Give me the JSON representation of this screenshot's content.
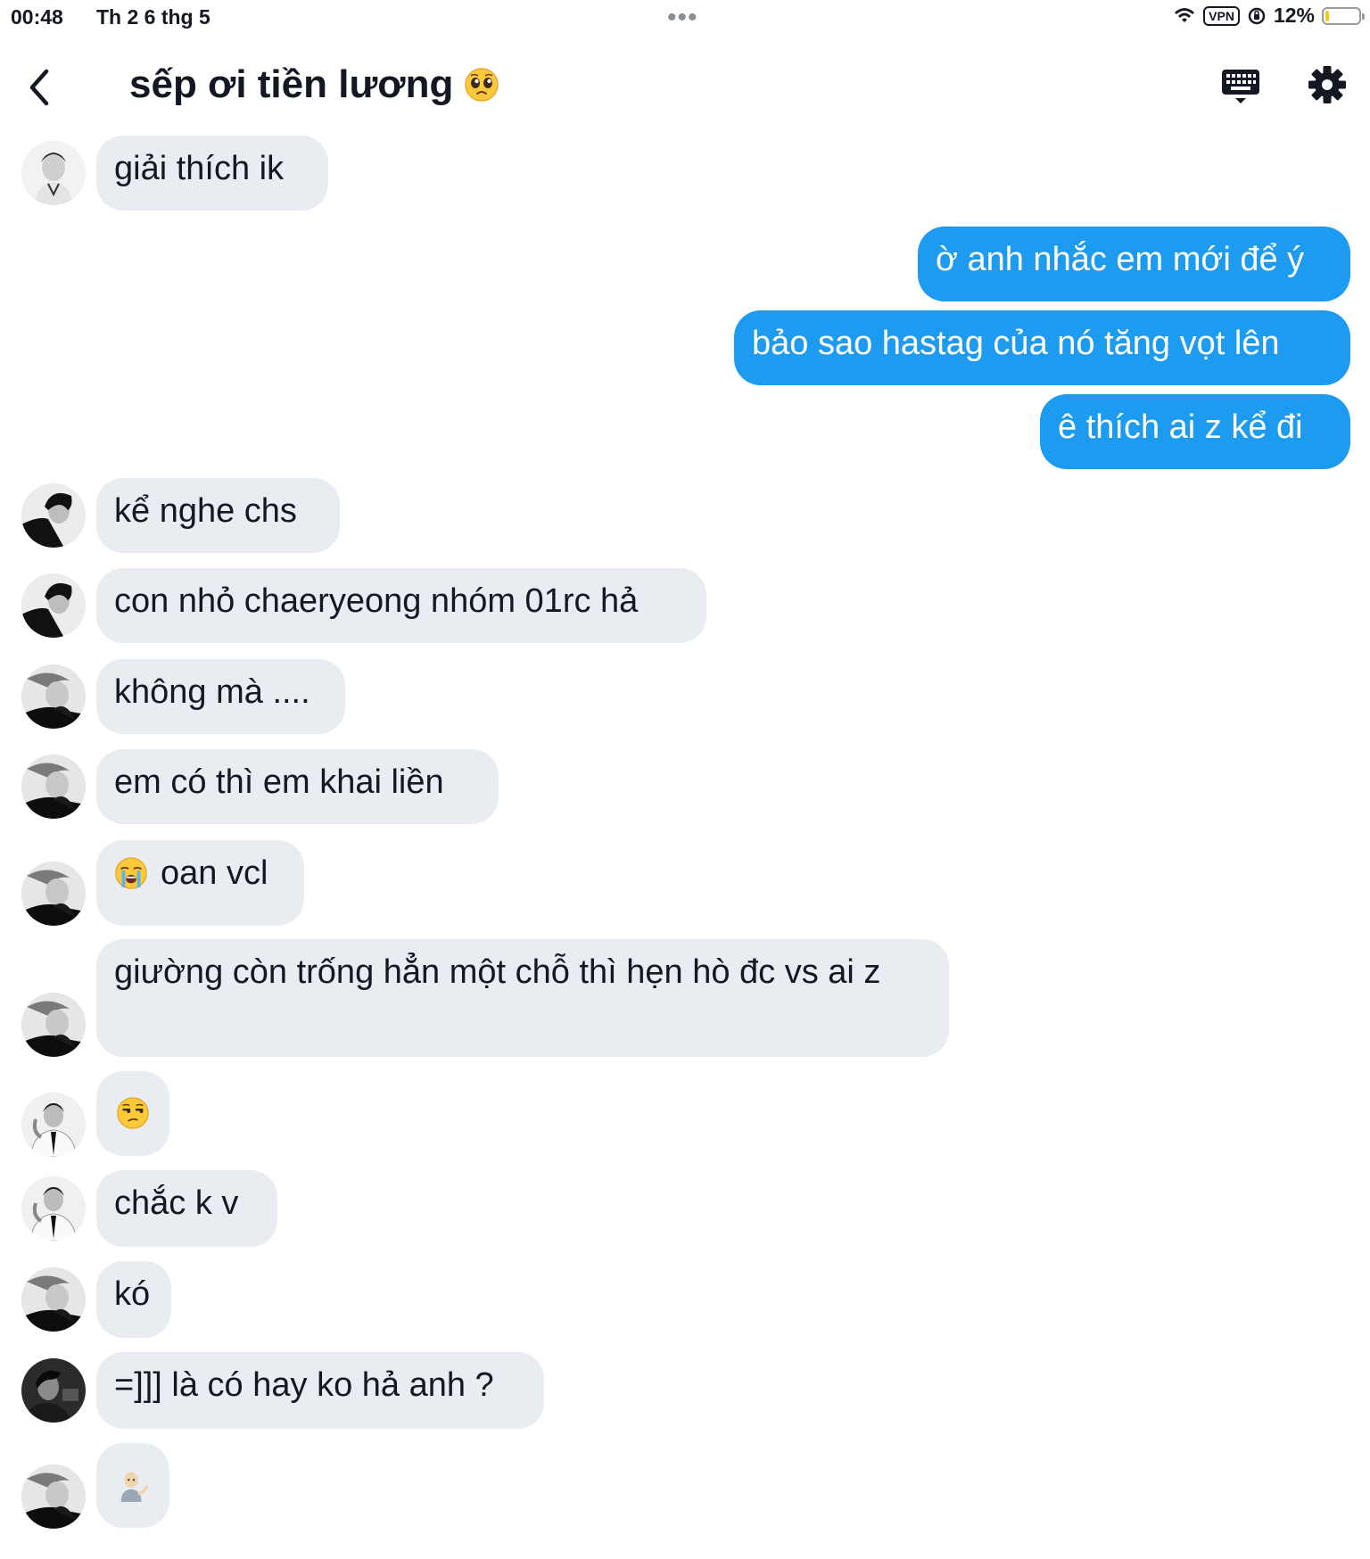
{
  "status_bar": {
    "time": "00:48",
    "date": "Th 2 6 thg 5",
    "vpn": "VPN",
    "battery_percent": "12%",
    "battery_level": 0.12
  },
  "header": {
    "title": "sếp ơi tiền lương",
    "title_emoji": "pleading-face-icon"
  },
  "colors": {
    "incoming_bubble": "#e9edf2",
    "outgoing_bubble": "#1d9bf0",
    "battery_low": "#f5c518"
  },
  "messages": [
    {
      "direction": "in",
      "avatar": "avatar-a",
      "text": "giải thích ik"
    },
    {
      "direction": "out",
      "text": "ờ anh nhắc em mới để ý"
    },
    {
      "direction": "out",
      "text": "bảo sao hastag của nó tăng vọt lên"
    },
    {
      "direction": "out",
      "text": "ê thích ai z kể đi"
    },
    {
      "direction": "in",
      "avatar": "avatar-b",
      "text": "kể nghe chs"
    },
    {
      "direction": "in",
      "avatar": "avatar-b",
      "text": "con nhỏ chaeryeong nhóm 01rc hả"
    },
    {
      "direction": "in",
      "avatar": "avatar-c",
      "text": "không mà ...."
    },
    {
      "direction": "in",
      "avatar": "avatar-c",
      "text": "em có thì em khai liền"
    },
    {
      "direction": "in",
      "avatar": "avatar-c",
      "text": "oan vcl",
      "emoji": "loudly-crying-face-icon"
    },
    {
      "direction": "in",
      "avatar": "avatar-c",
      "text": "giường còn trống hẳn một chỗ thì hẹn hò đc vs ai z"
    },
    {
      "direction": "in",
      "avatar": "avatar-d",
      "text": "",
      "emoji": "unamused-face-icon"
    },
    {
      "direction": "in",
      "avatar": "avatar-d",
      "text": "chắc k v"
    },
    {
      "direction": "in",
      "avatar": "avatar-c",
      "text": "kó"
    },
    {
      "direction": "in",
      "avatar": "avatar-e",
      "text": "=]]] là có hay ko hả anh ?"
    },
    {
      "direction": "in",
      "avatar": "avatar-c",
      "text": "",
      "emoji": "person-tipping-hand-icon"
    }
  ]
}
